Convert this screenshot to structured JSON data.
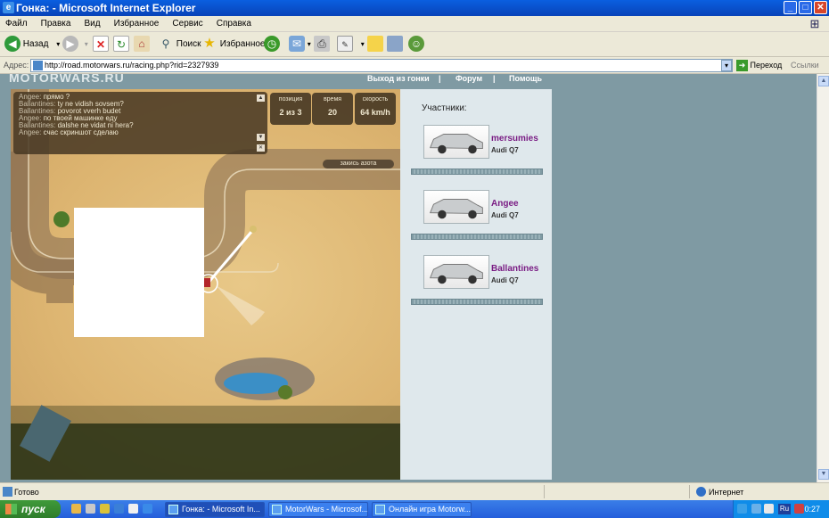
{
  "window": {
    "title": "Гонка: - Microsoft Internet Explorer",
    "buttons": {
      "minimize": "_",
      "maximize": "□",
      "close": "✕"
    }
  },
  "menu": [
    "Файл",
    "Правка",
    "Вид",
    "Избранное",
    "Сервис",
    "Справка"
  ],
  "toolbar": {
    "back": "Назад",
    "search": "Поиск",
    "favorites": "Избранное"
  },
  "address": {
    "label": "Адрес:",
    "url": "http://road.motorwars.ru/racing.php?rid=2327939",
    "go": "Переход",
    "links": "Ссылки"
  },
  "site": {
    "logo": "MOTORWARS.RU",
    "nav": [
      "Выход из гонки",
      "|",
      "Форум",
      "|",
      "Помощь"
    ]
  },
  "game": {
    "chat": [
      {
        "nick": "Angee:",
        "text": "прямо ?"
      },
      {
        "nick": "Ballantines:",
        "text": "ty ne vidish sovsem?"
      },
      {
        "nick": "Ballantines:",
        "text": "povorot vverh budet"
      },
      {
        "nick": "Angee:",
        "text": "по твоей машинке еду"
      },
      {
        "nick": "Ballantines:",
        "text": "dalshe ne vidat ni hera?"
      },
      {
        "nick": "Angee:",
        "text": "счас скриншот сделаю"
      }
    ],
    "stats": [
      {
        "label": "позиция",
        "value": "2 из 3"
      },
      {
        "label": "время",
        "value": "20"
      },
      {
        "label": "скорость",
        "value": "64 km/h"
      }
    ],
    "nitro_label": "закись азота"
  },
  "participants": {
    "title": "Участники:",
    "players": [
      {
        "name": "mersumies",
        "car": "Audi Q7"
      },
      {
        "name": "Angee",
        "car": "Audi Q7"
      },
      {
        "name": "Ballantines",
        "car": "Audi Q7"
      }
    ]
  },
  "status": {
    "text": "Готово",
    "zone": "Интернет"
  },
  "taskbar": {
    "start": "пуск",
    "tasks": [
      "Гонка: - Microsoft In...",
      "MotorWars - Microsof...",
      "Онлайн игра Motorw..."
    ],
    "lang": "Ru",
    "clock": "0:27"
  }
}
